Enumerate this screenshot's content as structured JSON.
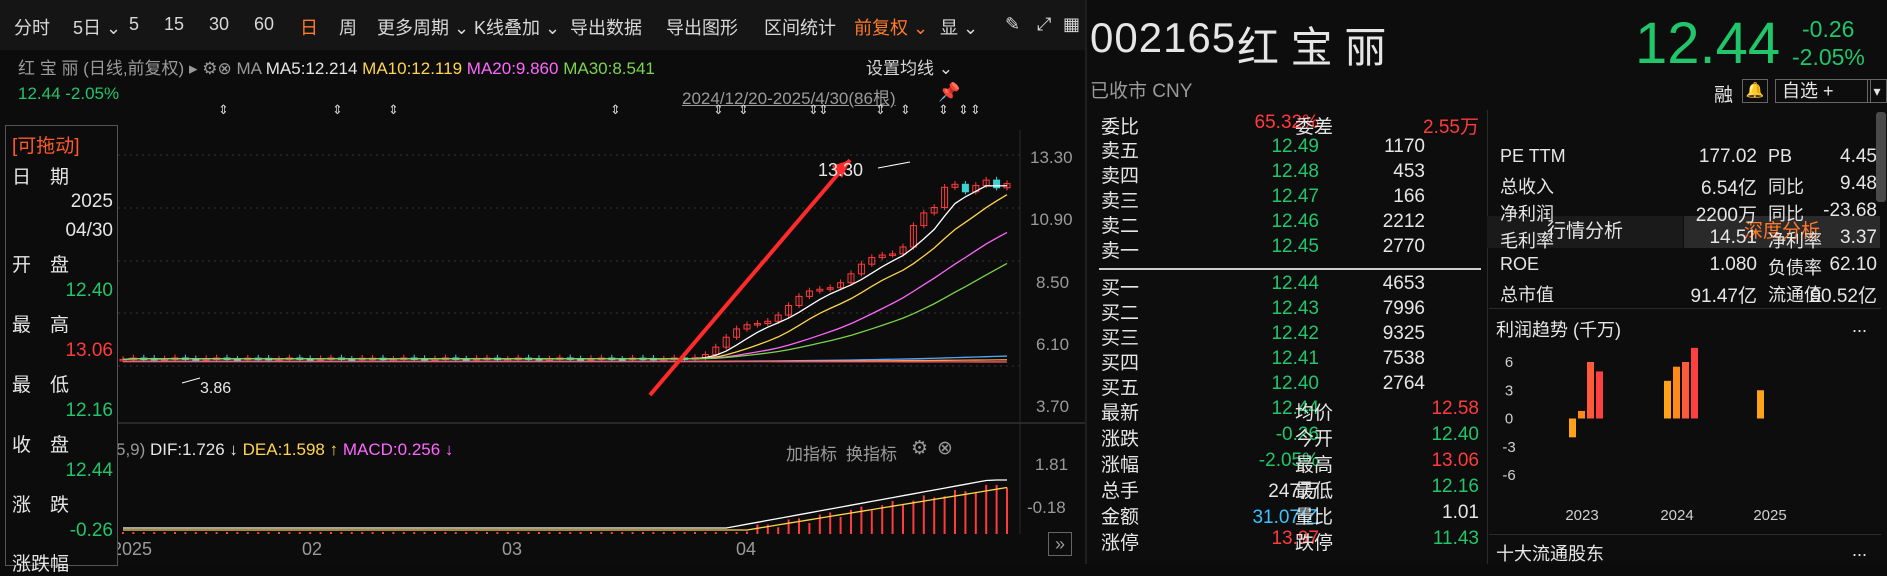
{
  "toolbar": {
    "items": [
      "分时",
      "5日",
      "5",
      "15",
      "30",
      "60",
      "日",
      "周",
      "更多周期",
      "K线叠加",
      "导出数据",
      "导出图形",
      "区间统计",
      "前复权",
      "显"
    ],
    "active_period": "日",
    "active_adjust": "前复权"
  },
  "chart": {
    "header_title": "红 宝 丽 (日线,前复权)",
    "ma_label": "MA",
    "ma5": "MA5:12.214",
    "ma10": "MA10:12.119",
    "ma20": "MA20:9.860",
    "ma30": "MA30:8.541",
    "set_ma": "设置均线",
    "price_line": "12.44  -2.05%",
    "range": "2024/12/20-2025/4/30(86根)",
    "y_ticks": [
      "13.30",
      "10.90",
      "8.50",
      "6.10",
      "3.70"
    ],
    "high_label": "13.30",
    "low_label": "3.86",
    "x_labels": [
      "2025",
      "02",
      "03",
      "04"
    ],
    "macd_params": "5,9)",
    "dif": "DIF:1.726",
    "dea": "DEA:1.598",
    "macd": "MACD:0.256",
    "add_indicator": "加指标",
    "switch_indicator": "换指标",
    "macd_ticks": [
      "1.81",
      "-0.18"
    ]
  },
  "info_panel": {
    "title": "[可拖动]",
    "date_label": "日　期",
    "year": "2025",
    "date": "04/30",
    "open_label": "开　盘",
    "open": "12.40",
    "high_label": "最　高",
    "high": "13.06",
    "low_label": "最　低",
    "low": "12.16",
    "close_label": "收　盘",
    "close": "12.44",
    "change_label": "涨　跌",
    "change": "-0.26",
    "pct_label": "涨跌幅"
  },
  "quote": {
    "code": "002165",
    "name": "红 宝 丽",
    "status": "已收市 CNY",
    "price": "12.44",
    "change": "-0.26",
    "pct": "-2.05%",
    "rong": "融",
    "watch": "自选 +"
  },
  "orderbook": {
    "weibi_label": "委比",
    "weibi": "65.32%",
    "weicha_label": "委差",
    "weicha": "2.55万",
    "asks": [
      {
        "label": "卖五",
        "price": "12.49",
        "vol": "1170"
      },
      {
        "label": "卖四",
        "price": "12.48",
        "vol": "453"
      },
      {
        "label": "卖三",
        "price": "12.47",
        "vol": "166"
      },
      {
        "label": "卖二",
        "price": "12.46",
        "vol": "2212"
      },
      {
        "label": "卖一",
        "price": "12.45",
        "vol": "2770"
      }
    ],
    "bids": [
      {
        "label": "买一",
        "price": "12.44",
        "vol": "4653"
      },
      {
        "label": "买二",
        "price": "12.43",
        "vol": "7996"
      },
      {
        "label": "买三",
        "price": "12.42",
        "vol": "9325"
      },
      {
        "label": "买四",
        "price": "12.41",
        "vol": "7538"
      },
      {
        "label": "买五",
        "price": "12.40",
        "vol": "2764"
      }
    ],
    "stats": [
      {
        "l1": "最新",
        "v1": "12.44",
        "l2": "均价",
        "v2": "12.58"
      },
      {
        "l1": "涨跌",
        "v1": "-0.26",
        "l2": "今开",
        "v2": "12.40"
      },
      {
        "l1": "涨幅",
        "v1": "-2.05%",
        "l2": "最高",
        "v2": "13.06"
      },
      {
        "l1": "总手",
        "v1": "247万",
        "l2": "最低",
        "v2": "12.16"
      },
      {
        "l1": "金额",
        "v1": "31.07亿",
        "l2": "量比",
        "v2": "1.01"
      },
      {
        "l1": "涨停",
        "v1": "13.97",
        "l2": "跌停",
        "v2": "11.43"
      }
    ]
  },
  "analysis": {
    "tab1": "行情分析",
    "tab2": "深度分析",
    "pe_label": "PE TTM",
    "pe": "177.02",
    "pb_label": "PB",
    "pb": "4.45",
    "rev_label": "总收入",
    "rev": "6.54亿",
    "rev_yoy_label": "同比",
    "rev_yoy": "9.48",
    "np_label": "净利润",
    "np": "2200万",
    "np_yoy_label": "同比",
    "np_yoy": "-23.68",
    "gm_label": "毛利率",
    "gm": "14.51",
    "nm_label": "净利率",
    "nm": "3.37",
    "roe_label": "ROE",
    "roe": "1.080",
    "debt_label": "负债率",
    "debt": "62.10",
    "mcap_label": "总市值",
    "mcap": "91.47亿",
    "float_label": "流通值",
    "float": "90.52亿",
    "profit_title": "利润趋势 (千万)",
    "more": "...",
    "holders_title": "十大流通股东"
  },
  "chart_data": {
    "type": "bar",
    "title": "利润趋势 (千万)",
    "x_labels": [
      "2023",
      "2024",
      "2025"
    ],
    "y_ticks": [
      "6",
      "3",
      "0",
      "-3",
      "-6"
    ],
    "ylim": [
      -6,
      6
    ],
    "series": [
      {
        "group": "2023",
        "values": [
          -2.0,
          0.8,
          6.0,
          5.0
        ]
      },
      {
        "group": "2024",
        "values": [
          4.0,
          5.5,
          6.0,
          7.5
        ]
      },
      {
        "group": "2025",
        "values": [
          3.0
        ]
      }
    ]
  }
}
